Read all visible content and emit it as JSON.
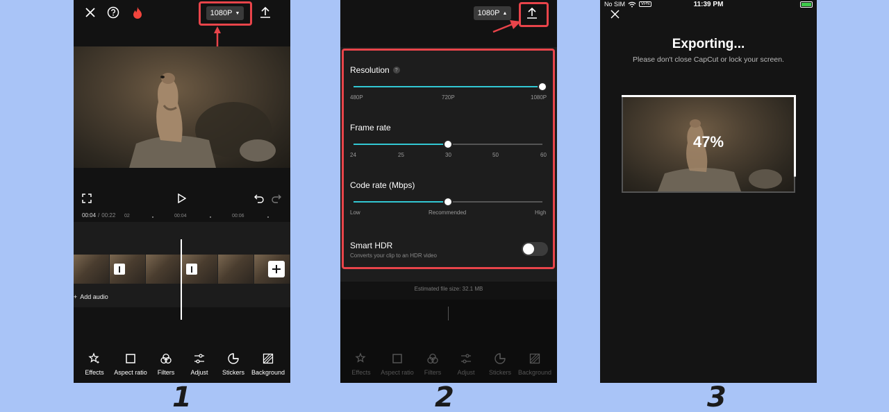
{
  "steps": [
    "1",
    "2",
    "3"
  ],
  "screen1": {
    "resolution": "1080P",
    "time_current": "00:04",
    "time_separator": "/",
    "time_total": "00:22",
    "ruler": [
      "02",
      "00:04",
      "00:06"
    ],
    "add_audio": "Add audio",
    "toolbar": [
      {
        "label": "Effects",
        "icon": "effects-icon"
      },
      {
        "label": "Aspect ratio",
        "icon": "aspect-ratio-icon"
      },
      {
        "label": "Filters",
        "icon": "filters-icon"
      },
      {
        "label": "Adjust",
        "icon": "adjust-icon"
      },
      {
        "label": "Stickers",
        "icon": "stickers-icon"
      },
      {
        "label": "Background",
        "icon": "background-icon"
      }
    ]
  },
  "screen2": {
    "resolution": "1080P",
    "resolution_label": "Resolution",
    "resolution_ticks": [
      "480P",
      "720P",
      "1080P"
    ],
    "resolution_value": 1.0,
    "frame_rate_label": "Frame rate",
    "frame_rate_ticks": [
      "24",
      "25",
      "30",
      "50",
      "60"
    ],
    "frame_rate_value": "30",
    "code_rate_label": "Code rate (Mbps)",
    "code_rate_ticks": [
      "Low",
      "Recommended",
      "High"
    ],
    "code_rate_value": "Recommended",
    "hdr_label": "Smart HDR",
    "hdr_desc": "Converts your clip to an HDR video",
    "hdr_on": false,
    "file_size": "Estimated file size: 32.1 MB",
    "toolbar": [
      "Effects",
      "Aspect ratio",
      "Filters",
      "Adjust",
      "Stickers",
      "Background"
    ]
  },
  "screen3": {
    "carrier": "No SIM",
    "vpn": "VPN",
    "time": "11:39 PM",
    "title": "Exporting...",
    "subtitle": "Please don't close CapCut or lock your screen.",
    "progress": "47%",
    "progress_value": 0.47
  },
  "colors": {
    "accent": "#32c8d4",
    "highlight": "#e8444a",
    "flame": "#f2453d",
    "background": "#a9c4f7"
  }
}
